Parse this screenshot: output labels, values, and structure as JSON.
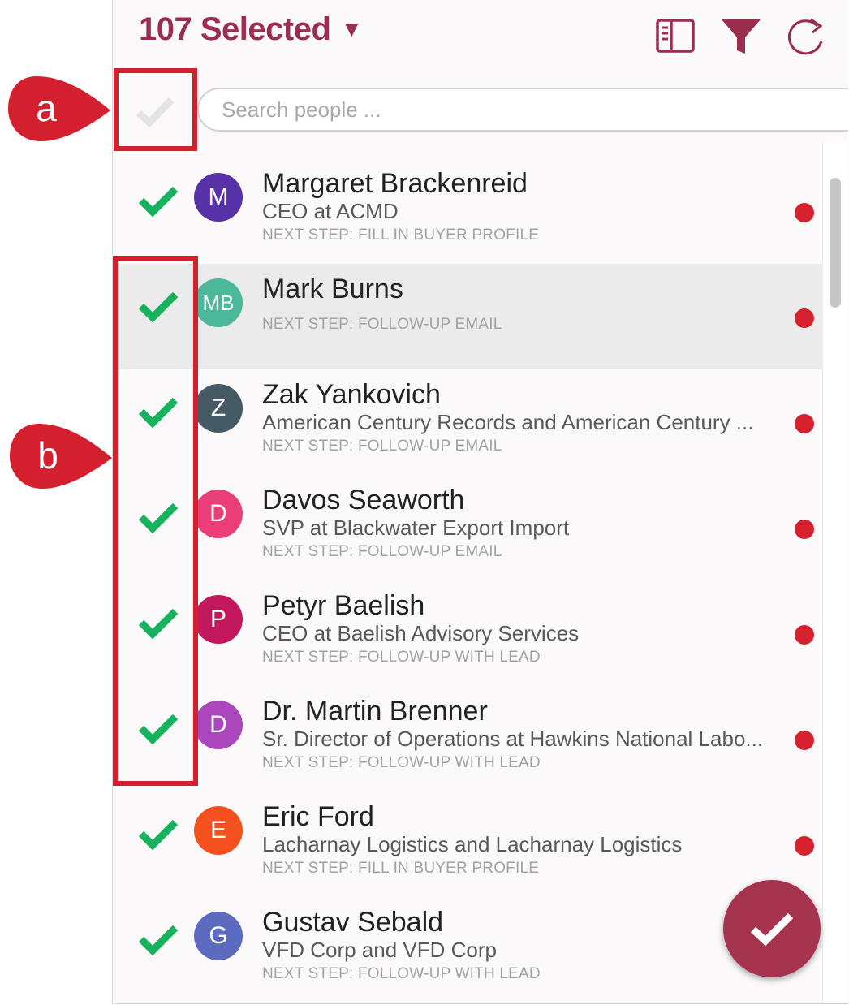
{
  "header": {
    "title": "107 Selected",
    "caret": "▼",
    "icons": [
      "sidebar-panel-icon",
      "filter-icon",
      "refresh-icon"
    ]
  },
  "colors": {
    "brand": "#9b2e4e",
    "check": "#17b25c",
    "status_dot": "#d6222e",
    "fab": "#a7344f",
    "callout": "#d4202e"
  },
  "search": {
    "placeholder": "Search people ..."
  },
  "people": [
    {
      "initials": "M",
      "name": "Margaret Brackenreid",
      "subtitle": "CEO at ACMD",
      "next_step": "NEXT STEP: FILL IN BUYER PROFILE",
      "avatar_color": "#5631a8"
    },
    {
      "initials": "MB",
      "name": "Mark Burns",
      "subtitle": "",
      "next_step": "NEXT STEP: FOLLOW-UP EMAIL",
      "avatar_color": "#4cb89a"
    },
    {
      "initials": "Z",
      "name": "Zak Yankovich",
      "subtitle": "American Century Records and American Century ...",
      "next_step": "NEXT STEP: FOLLOW-UP EMAIL",
      "avatar_color": "#455a64"
    },
    {
      "initials": "D",
      "name": "Davos Seaworth",
      "subtitle": "SVP at Blackwater Export Import",
      "next_step": "NEXT STEP: FOLLOW-UP EMAIL",
      "avatar_color": "#eb3f79"
    },
    {
      "initials": "P",
      "name": "Petyr Baelish",
      "subtitle": "CEO at Baelish Advisory Services",
      "next_step": "NEXT STEP: FOLLOW-UP WITH LEAD",
      "avatar_color": "#c3185d"
    },
    {
      "initials": "D",
      "name": "Dr. Martin Brenner",
      "subtitle": "Sr. Director of Operations at Hawkins National Labo...",
      "next_step": "NEXT STEP: FOLLOW-UP WITH LEAD",
      "avatar_color": "#ab47bc"
    },
    {
      "initials": "E",
      "name": "Eric Ford",
      "subtitle": "Lacharnay Logistics and Lacharnay Logistics",
      "next_step": "NEXT STEP: FILL IN BUYER PROFILE",
      "avatar_color": "#f4511e"
    },
    {
      "initials": "G",
      "name": "Gustav Sebald",
      "subtitle": "VFD Corp and VFD Corp",
      "next_step": "NEXT STEP: FOLLOW-UP WITH LEAD",
      "avatar_color": "#5c6bc0"
    }
  ],
  "callouts": {
    "a": "a",
    "b": "b"
  }
}
